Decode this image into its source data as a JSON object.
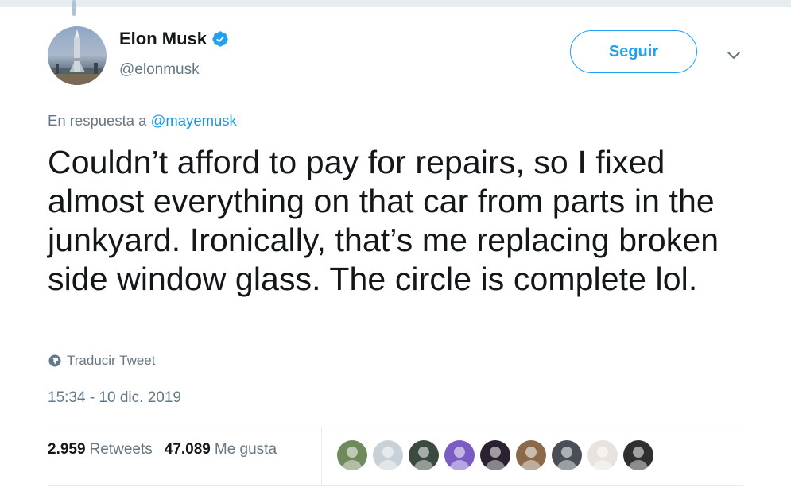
{
  "tweet": {
    "author": {
      "name": "Elon Musk",
      "handle": "@elonmusk",
      "verified": true,
      "avatar_icon": "rocket-icon"
    },
    "follow_label": "Seguir",
    "reply_prefix": "En respuesta a",
    "reply_mention": "@mayemusk",
    "text": "Couldn’t afford to pay for repairs, so I fixed almost everything on that car from parts in the junkyard. Ironically, that’s me replacing broken side window glass. The circle is complete lol.",
    "translate_label": "Traducir Tweet",
    "timestamp": "15:34 - 10 dic. 2019",
    "retweets": {
      "count": "2.959",
      "label": "Retweets"
    },
    "likes": {
      "count": "47.089",
      "label": "Me gusta"
    }
  },
  "colors": {
    "accent": "#1da1f2",
    "link": "#1b95e0",
    "secondary_text": "#657786",
    "primary_text": "#14171a",
    "divider": "#e6ecf0"
  },
  "likers": [
    {
      "name": "liker-1",
      "bg": "#6f8a5a"
    },
    {
      "name": "liker-2",
      "bg": "#c9d1d8"
    },
    {
      "name": "liker-3",
      "bg": "#3b4a3f"
    },
    {
      "name": "liker-4",
      "bg": "#7b5cc4"
    },
    {
      "name": "liker-5",
      "bg": "#2a2230"
    },
    {
      "name": "liker-6",
      "bg": "#8a6a4a"
    },
    {
      "name": "liker-7",
      "bg": "#4a4f57"
    },
    {
      "name": "liker-8",
      "bg": "#e8e3de"
    },
    {
      "name": "liker-9",
      "bg": "#2f2f2f"
    }
  ]
}
